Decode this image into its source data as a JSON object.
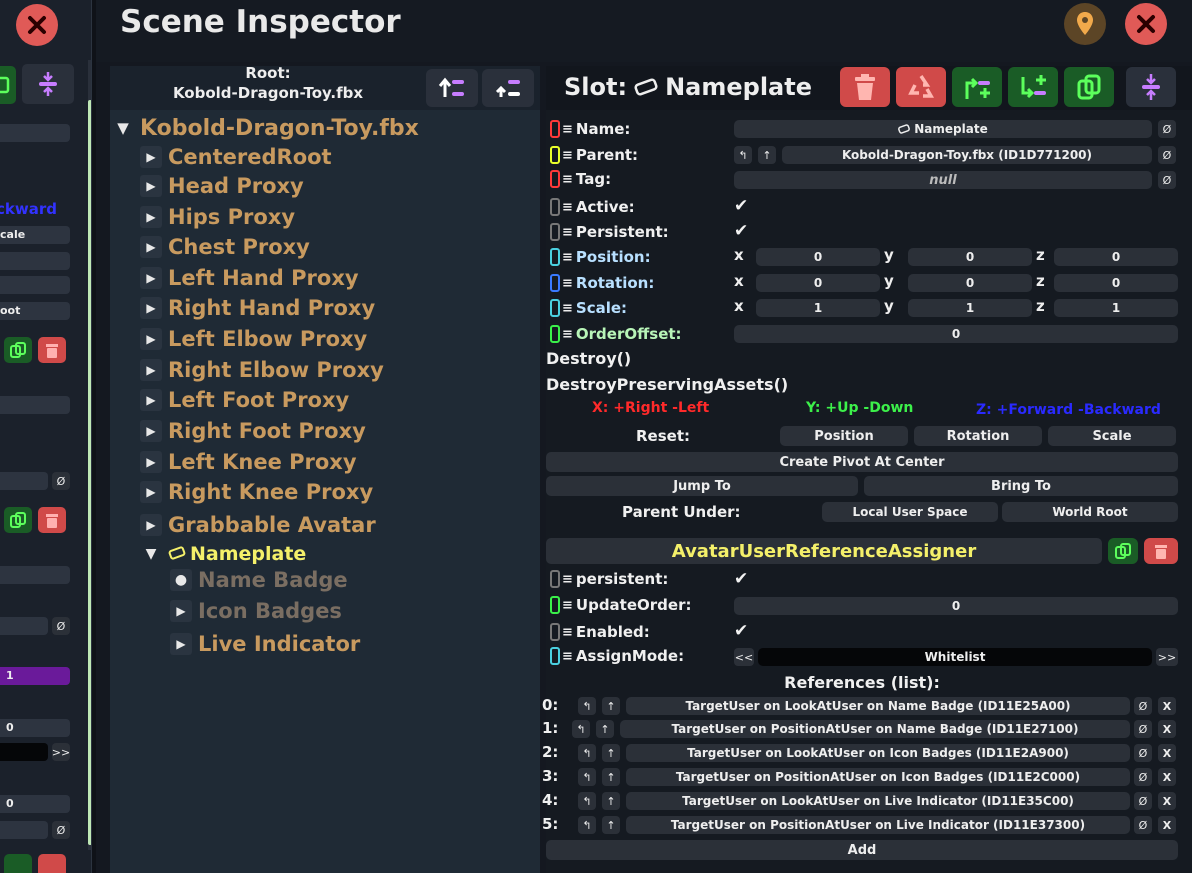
{
  "left_panel": {
    "fields": [
      "",
      "ckward",
      "cale",
      "",
      "",
      "oot",
      "",
      "",
      "",
      "",
      "1",
      "0",
      "",
      "0",
      ""
    ],
    "null_glyph": "Ø",
    "stepper_glyph": ">>"
  },
  "window": {
    "title": "Scene Inspector"
  },
  "hierarchy": {
    "root_caption": "Root:",
    "root_file": "Kobold-Dragon-Toy.fbx",
    "root_node": "Kobold-Dragon-Toy.fbx",
    "children": [
      "CenteredRoot",
      "Head Proxy",
      "Hips Proxy",
      "Chest Proxy",
      "Left Hand Proxy",
      "Right Hand Proxy",
      "Left Elbow Proxy",
      "Right Elbow Proxy",
      "Left Foot Proxy",
      "Right Foot Proxy",
      "Left Knee Proxy",
      "Right Knee Proxy",
      "Grabbable Avatar"
    ],
    "selected": "Nameplate",
    "selected_children": [
      "Name Badge",
      "Icon Badges",
      "Live Indicator"
    ]
  },
  "slot": {
    "header_prefix": "Slot:",
    "header_name": "Nameplate",
    "fields": {
      "name_label": "Name:",
      "name_value": "Nameplate",
      "parent_label": "Parent:",
      "parent_value": "Kobold-Dragon-Toy.fbx (ID1D771200)",
      "tag_label": "Tag:",
      "tag_value": "null",
      "active_label": "Active:",
      "persistent_label": "Persistent:",
      "position_label": "Position:",
      "rotation_label": "Rotation:",
      "scale_label": "Scale:",
      "orderoffset_label": "OrderOffset:",
      "orderoffset_value": "0"
    },
    "position": {
      "x": "0",
      "y": "0",
      "z": "0"
    },
    "rotation": {
      "x": "0",
      "y": "0",
      "z": "0"
    },
    "scale": {
      "x": "1",
      "y": "1",
      "z": "1"
    },
    "axis_letters": {
      "x": "x",
      "y": "y",
      "z": "z"
    },
    "null_glyph": "Ø",
    "check_glyph": "✔",
    "destroy": "Destroy()",
    "destroy_preserving": "DestroyPreservingAssets()",
    "axis_legend": {
      "x": "X: +Right -Left",
      "y": "Y: +Up -Down",
      "z": "Z: +Forward -Backward"
    },
    "reset_label": "Reset:",
    "reset_buttons": [
      "Position",
      "Rotation",
      "Scale"
    ],
    "create_pivot": "Create Pivot At Center",
    "jump_to": "Jump To",
    "bring_to": "Bring To",
    "parent_under_label": "Parent Under:",
    "local_user_space": "Local User Space",
    "world_root": "World Root"
  },
  "component": {
    "title": "AvatarUserReferenceAssigner",
    "persistent_label": "persistent:",
    "updateorder_label": "UpdateOrder:",
    "updateorder_value": "0",
    "enabled_label": "Enabled:",
    "assignmode_label": "AssignMode:",
    "assignmode_value": "Whitelist",
    "prev_glyph": "<<",
    "next_glyph": ">>",
    "references_title": "References (list):",
    "references": [
      {
        "index": "0:",
        "value": "TargetUser on LookAtUser on Name Badge (ID11E25A00)"
      },
      {
        "index": "1:",
        "value": "TargetUser on PositionAtUser on Name Badge (ID11E27100)"
      },
      {
        "index": "2:",
        "value": "TargetUser on LookAtUser on Icon Badges (ID11E2A900)"
      },
      {
        "index": "3:",
        "value": "TargetUser on PositionAtUser on Icon Badges (ID11E2C000)"
      },
      {
        "index": "4:",
        "value": "TargetUser on LookAtUser on Live Indicator (ID11E35C00)"
      },
      {
        "index": "5:",
        "value": "TargetUser on PositionAtUser on Live Indicator (ID11E37300)"
      }
    ],
    "remove_glyph": "X",
    "add_label": "Add"
  },
  "colors": {
    "tree_text": "#c89a5f",
    "selected_text": "#f4f06a",
    "muted_text": "#7a6e62",
    "axis_x": "#ff2a2a",
    "axis_y": "#3cf04a",
    "axis_z": "#2a2aff",
    "green_button": "#1a5c26",
    "red_button": "#d04a49"
  }
}
